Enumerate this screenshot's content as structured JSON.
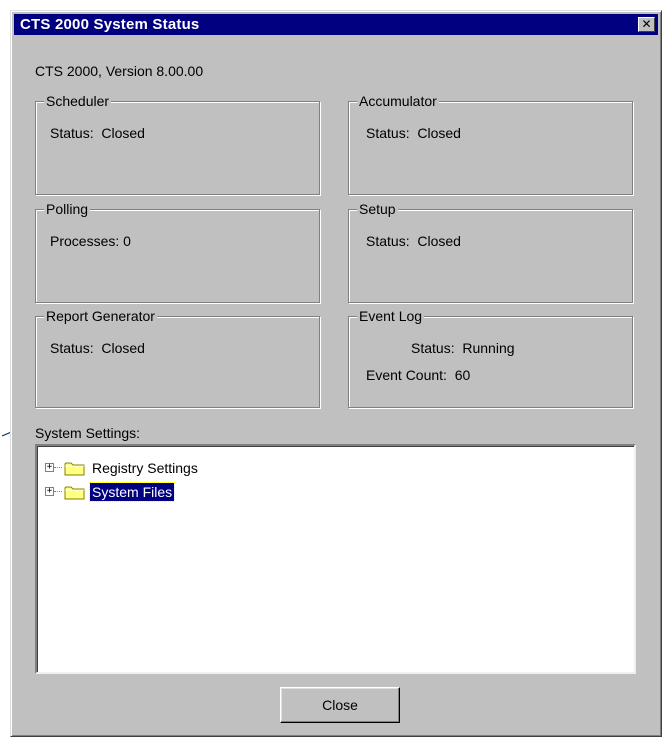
{
  "window": {
    "title": "CTS 2000 System Status",
    "close_glyph": "✕"
  },
  "version_text": "CTS 2000, Version 8.00.00",
  "groups": {
    "scheduler": {
      "title": "Scheduler",
      "lines": [
        "Status:  Closed"
      ]
    },
    "accumulator": {
      "title": "Accumulator",
      "lines": [
        "Status:  Closed"
      ]
    },
    "polling": {
      "title": "Polling",
      "lines": [
        "Processes: 0"
      ]
    },
    "setup": {
      "title": "Setup",
      "lines": [
        "Status:  Closed"
      ]
    },
    "report_generator": {
      "title": "Report Generator",
      "lines": [
        "Status:  Closed"
      ]
    },
    "event_log": {
      "title": "Event Log",
      "lines": [
        "Status:  Running",
        "Event Count:  60"
      ]
    }
  },
  "system_settings": {
    "label": "System Settings:",
    "items": [
      {
        "label": "Registry Settings",
        "icon": "folder-icon",
        "expander": "+",
        "selected": false
      },
      {
        "label": "System Files",
        "icon": "folder-icon",
        "expander": "+",
        "selected": true
      }
    ]
  },
  "buttons": {
    "close_label": "Close"
  },
  "colors": {
    "titlebar": "#000080",
    "face": "#c0c0c0",
    "selection": "#000080",
    "folder": "#ffff80"
  }
}
